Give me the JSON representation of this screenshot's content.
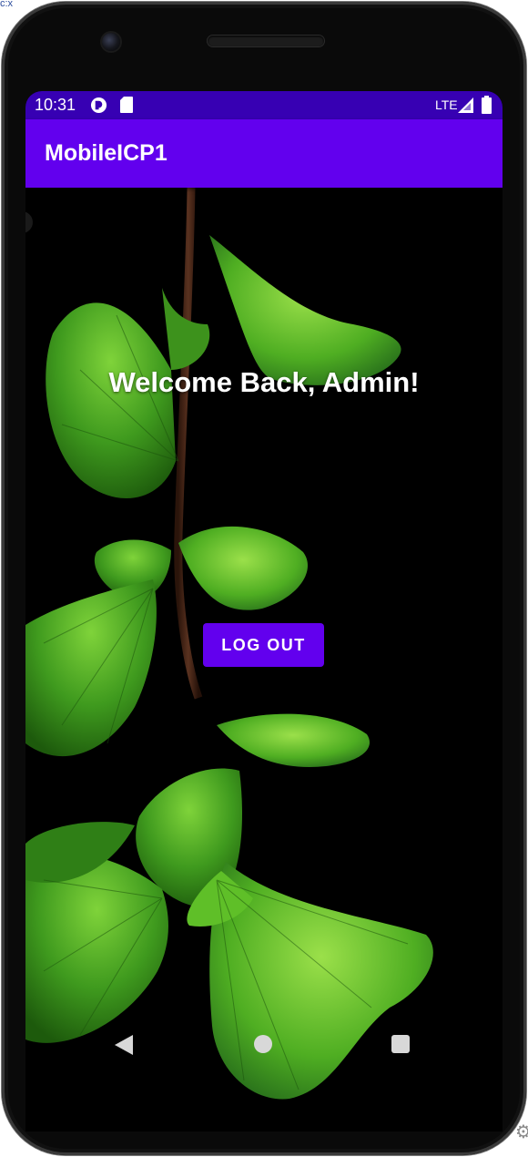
{
  "status_bar": {
    "time": "10:31",
    "network": "LTE",
    "icons": [
      "notification-app-icon",
      "sd-card-icon",
      "signal-icon",
      "battery-icon"
    ]
  },
  "app_bar": {
    "title": "MobileICP1",
    "color": "#6200ee",
    "status_color": "#3700b3"
  },
  "main": {
    "welcome_text": "Welcome Back, Admin!",
    "logout_label": "LOG OUT",
    "background": "ginkgo-leaves-image"
  },
  "nav_bar": {
    "buttons": [
      "back-icon",
      "home-icon",
      "recent-apps-icon"
    ]
  },
  "frame": {
    "top_text": "c:x",
    "corner_icon": "gear-icon"
  }
}
